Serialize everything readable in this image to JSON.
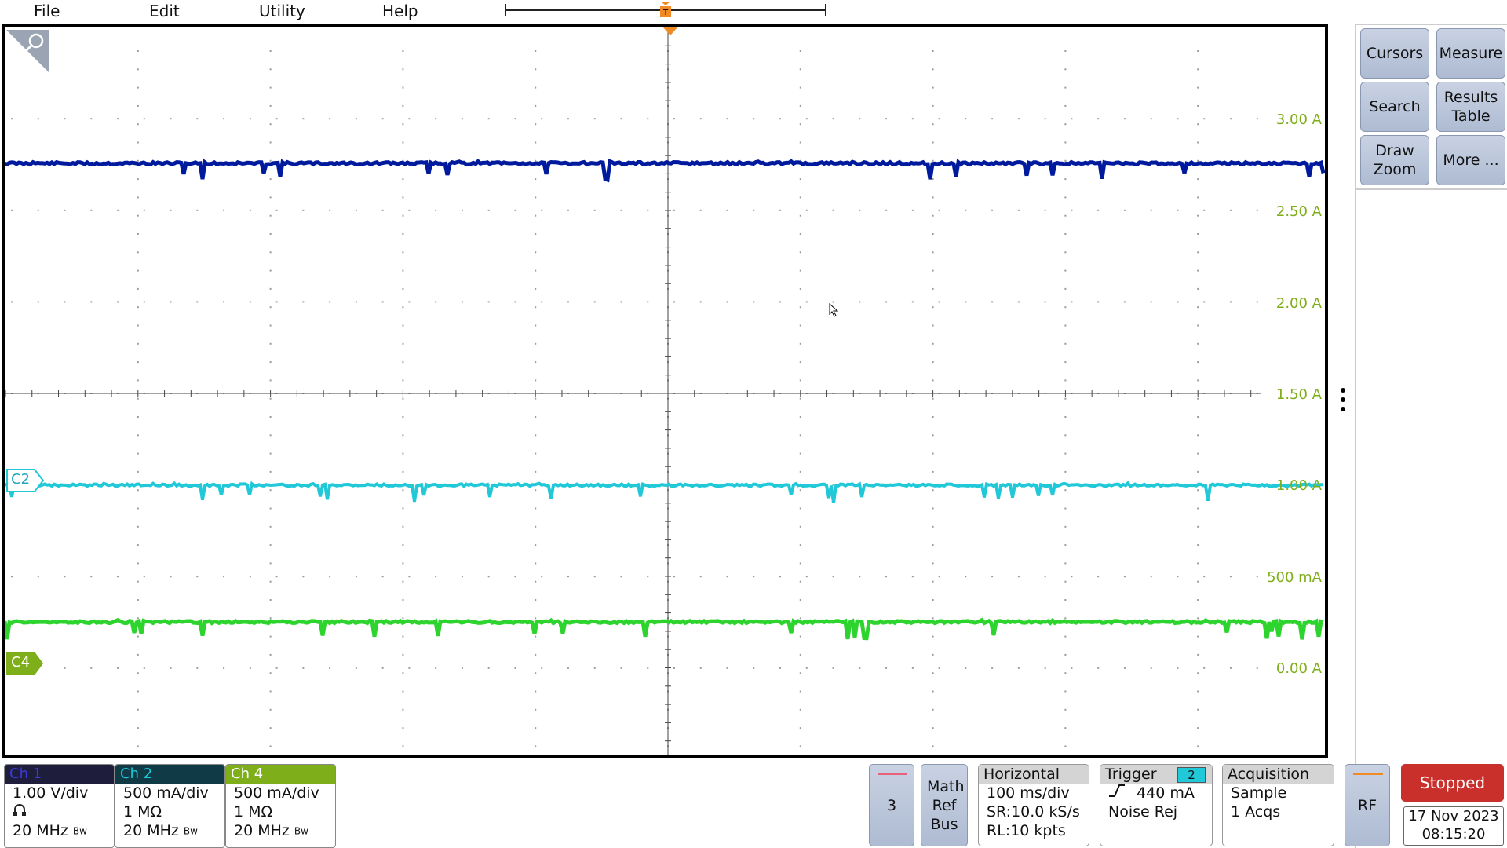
{
  "menu": {
    "file": "File",
    "edit": "Edit",
    "utility": "Utility",
    "help": "Help"
  },
  "scale_labels": [
    "3.00 A",
    "2.50 A",
    "2.00 A",
    "1.50 A",
    "1.00 A",
    "500 mA",
    "0.00 A"
  ],
  "markers": {
    "c2": "C2",
    "c4": "C4"
  },
  "right_panel": {
    "cursors": "Cursors",
    "measure": "Measure",
    "search": "Search",
    "results_table": "Results Table",
    "draw_zoom": "Draw Zoom",
    "more": "More ..."
  },
  "channels": {
    "ch1": {
      "title": "Ch 1",
      "scale": "1.00 V/div",
      "bandwidth": "20 MHz",
      "bw_mark": "Bw",
      "color": "#1e1e3c"
    },
    "ch2": {
      "title": "Ch 2",
      "scale": "500 mA/div",
      "impedance": "1 MΩ",
      "bandwidth": "20 MHz",
      "bw_mark": "Bw",
      "color": "#103a46"
    },
    "ch4": {
      "title": "Ch 4",
      "scale": "500 mA/div",
      "impedance": "1 MΩ",
      "bandwidth": "20 MHz",
      "bw_mark": "Bw",
      "color": "#7fae1b"
    }
  },
  "buttons": {
    "add_channel": "3",
    "math_ref_bus": "Math Ref Bus",
    "rf": "RF"
  },
  "horizontal": {
    "title": "Horizontal",
    "scale": "100 ms/div",
    "sr": "SR:10.0 kS/s",
    "rl": "RL:10 kpts"
  },
  "trigger": {
    "title": "Trigger",
    "source": "2",
    "level": "440 mA",
    "mode": "Noise Rej"
  },
  "acquisition": {
    "title": "Acquisition",
    "mode": "Sample",
    "count": "1 Acqs"
  },
  "status": {
    "state": "Stopped",
    "date": "17 Nov 2023",
    "time": "08:15:20"
  },
  "colors": {
    "ch1_trace": "#001a9e",
    "ch2_trace": "#20c8d8",
    "ch4_trace": "#2ed42e",
    "scale_text": "#7fae1b",
    "trigger_marker": "#f08a24"
  }
}
